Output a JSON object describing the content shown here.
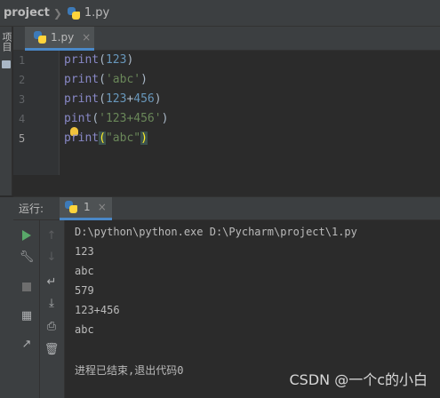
{
  "breadcrumb": {
    "project": "project",
    "file": "1.py"
  },
  "left_strip": {
    "label": "项目"
  },
  "editor_tab": {
    "label": "1.py",
    "close": "×"
  },
  "editor": {
    "line_numbers": [
      "1",
      "2",
      "3",
      "4",
      "5"
    ],
    "lines": [
      {
        "fn": "print",
        "open": "(",
        "arg": "123",
        "close": ")"
      },
      {
        "fn": "print",
        "open": "(",
        "arg": "'abc'",
        "close": ")"
      },
      {
        "fn": "print",
        "open": "(",
        "arg1": "123",
        "op": "+",
        "arg2": "456",
        "close": ")"
      },
      {
        "fn_a": "p",
        "fn_b": "int",
        "open": "(",
        "arg": "'123+456'",
        "close": ")"
      },
      {
        "fn": "print",
        "open": "(",
        "arg": "\"abc\"",
        "close": ")"
      }
    ]
  },
  "run_panel": {
    "title": "运行:",
    "tab_label": "1",
    "close": "×"
  },
  "console": {
    "lines": [
      "D:\\python\\python.exe D:\\Pycharm\\project\\1.py",
      "123",
      "abc",
      "579",
      "123+456",
      "abc",
      "",
      "进程已结束,退出代码0"
    ]
  },
  "watermark": "CSDN @一个c的小白",
  "colors": {
    "accent": "#4a88c7",
    "run_green": "#59a869",
    "bulb": "#f0c33c"
  },
  "icons": [
    "python-file-icon",
    "run-icon",
    "wrench-icon",
    "stop-icon",
    "layout-icon",
    "pin-icon",
    "up-arrow-icon",
    "down-arrow-icon",
    "soft-wrap-icon",
    "scroll-to-end-icon",
    "print-icon",
    "trash-icon",
    "lightbulb-icon"
  ]
}
